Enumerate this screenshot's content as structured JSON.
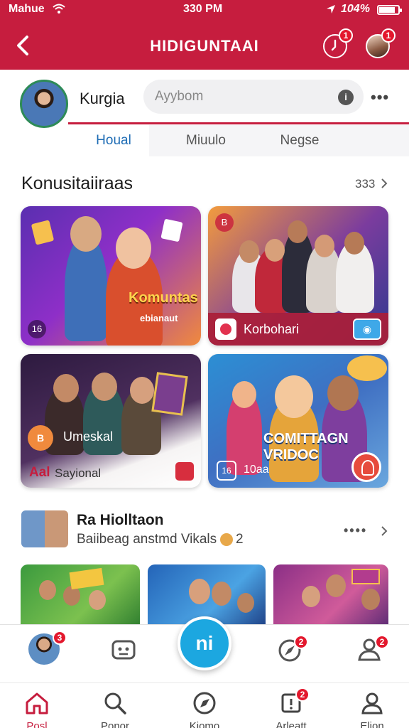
{
  "status_bar": {
    "carrier": "Mahue",
    "time": "330 PM",
    "battery": "104%"
  },
  "header": {
    "title": "HIDIGUNTAAI",
    "clock_badge": "1",
    "avatar_badge": "1"
  },
  "profile": {
    "name": "Kurgia",
    "search_placeholder": "Ayybom",
    "search_info": "i",
    "more": "•••"
  },
  "tabs": [
    {
      "label": "Houal",
      "active": true
    },
    {
      "label": "Miuulo",
      "active": false
    },
    {
      "label": "Negse",
      "active": false
    }
  ],
  "section1": {
    "title": "Konusitaiiraas",
    "more": "333",
    "cards": [
      {
        "overlay": "Komuntas",
        "caption": "ebianaut",
        "chip": "16"
      },
      {
        "footer_label": "Korbohari",
        "chip": "B"
      },
      {
        "label": "Umeskal",
        "logo": "B",
        "foot_a": "Aal",
        "foot_b": "Sayional"
      },
      {
        "big": "COMITTAGN VRIDOC",
        "small": "10aa",
        "chip": "16"
      }
    ]
  },
  "section2": {
    "title": "Ra Hiolltaon",
    "subtitle": "Baiibeag anstmd Vikals",
    "count": "2",
    "more": "••••"
  },
  "tabbar": {
    "avatar_badge": "3",
    "fab_label": "ni",
    "compass_badge": "2",
    "profile_badge": "2"
  },
  "bottom_nav": [
    {
      "label": "Posl",
      "icon": "home-icon",
      "active": true
    },
    {
      "label": "Ponor",
      "icon": "search-icon",
      "active": false
    },
    {
      "label": "Kiomo",
      "icon": "compass-icon",
      "active": false
    },
    {
      "label": "Arleatt",
      "icon": "alert-icon",
      "active": false,
      "badge": "2"
    },
    {
      "label": "Elion",
      "icon": "person-icon",
      "active": false
    }
  ],
  "colors": {
    "brand_red": "#c61d3e",
    "accent_blue": "#1ca7e0",
    "badge_red": "#e3182d"
  }
}
